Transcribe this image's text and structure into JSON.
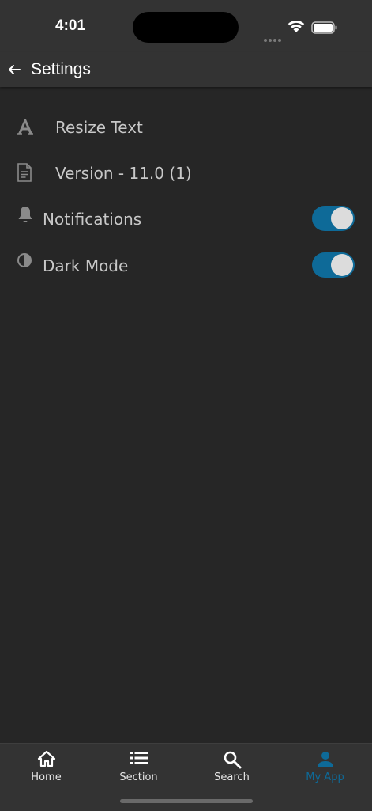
{
  "status_bar": {
    "time": "4:01"
  },
  "header": {
    "title": "Settings",
    "back_icon": "arrow-left-icon"
  },
  "settings": {
    "items": [
      {
        "label": "Resize Text",
        "icon": "font-size-icon"
      },
      {
        "label": "Version - 11.0 (1)",
        "icon": "document-icon"
      },
      {
        "label": "Notifications",
        "icon": "bell-icon",
        "toggle_on": true
      },
      {
        "label": "Dark Mode",
        "icon": "contrast-icon",
        "toggle_on": true
      }
    ]
  },
  "bottom_nav": {
    "items": [
      {
        "label": "Home",
        "icon": "home-icon"
      },
      {
        "label": "Section",
        "icon": "list-icon"
      },
      {
        "label": "Search",
        "icon": "search-icon"
      },
      {
        "label": "My App",
        "icon": "person-icon",
        "active": true
      }
    ]
  },
  "colors": {
    "background": "#262626",
    "bar": "#333333",
    "accent": "#0e6a98",
    "text": "#c8c8c8"
  }
}
